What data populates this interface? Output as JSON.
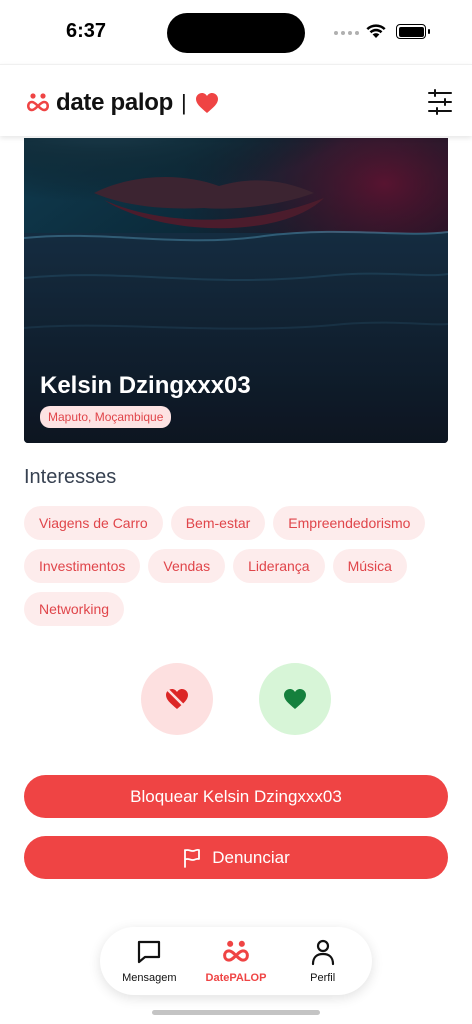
{
  "status_bar": {
    "time": "6:37"
  },
  "header": {
    "brand": "date palop",
    "separator": "|"
  },
  "profile": {
    "name": "Kelsin Dzingxxx03",
    "location": "Maputo, Moçambique"
  },
  "interests": {
    "title": "Interesses",
    "tags": [
      "Viagens de Carro",
      "Bem-estar",
      "Empreendedorismo",
      "Investimentos",
      "Vendas",
      "Liderança",
      "Música",
      "Networking"
    ]
  },
  "actions": {
    "block_label": "Bloquear Kelsin Dzingxxx03",
    "report_label": "Denunciar"
  },
  "nav": {
    "items": [
      {
        "label": "Mensagem",
        "icon": "message-icon"
      },
      {
        "label": "DatePALOP",
        "icon": "datepalop-logo-icon"
      },
      {
        "label": "Perfil",
        "icon": "profile-icon"
      }
    ],
    "active_index": 1
  },
  "colors": {
    "accent": "#ef4444",
    "tag_bg": "#fdecec",
    "tag_text": "#e0454a",
    "like_bg": "#d7f5d7",
    "like_icon": "#15803d",
    "dislike_bg": "#fde0e0"
  }
}
